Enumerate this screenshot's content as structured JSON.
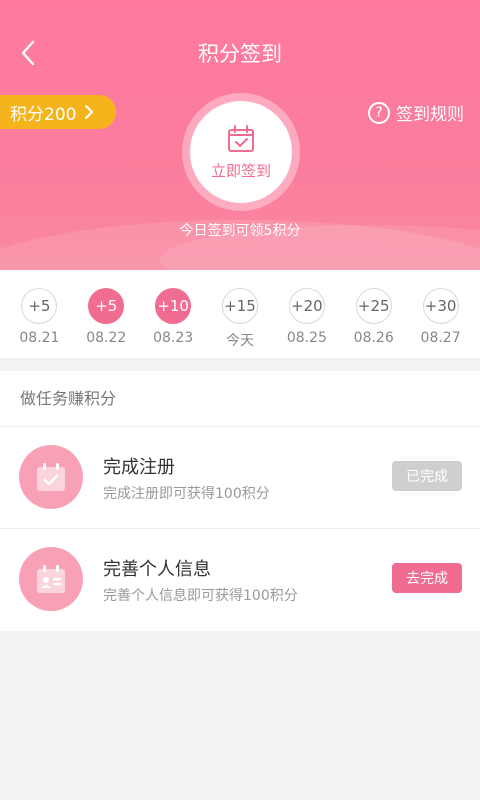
{
  "header": {
    "title": "积分签到",
    "points_label": "积分200",
    "rules_label": "签到规则",
    "sign_button_label": "立即签到",
    "sign_tip": "今日签到可领5积分"
  },
  "days": [
    {
      "points": "+5",
      "date": "08.21",
      "done": false
    },
    {
      "points": "+5",
      "date": "08.22",
      "done": true
    },
    {
      "points": "+10",
      "date": "08.23",
      "done": true
    },
    {
      "points": "+15",
      "date": "今天",
      "done": false
    },
    {
      "points": "+20",
      "date": "08.25",
      "done": false
    },
    {
      "points": "+25",
      "date": "08.26",
      "done": false
    },
    {
      "points": "+30",
      "date": "08.27",
      "done": false
    }
  ],
  "tasks": {
    "heading": "做任务赚积分",
    "items": [
      {
        "title": "完成注册",
        "desc": "完成注册即可获得100积分",
        "button": "已完成",
        "status": "complete"
      },
      {
        "title": "完善个人信息",
        "desc": "完善个人信息即可获得100积分",
        "button": "去完成",
        "status": "pending"
      }
    ]
  },
  "colors": {
    "accent": "#f06c90",
    "header_bg": "#fb7c9d",
    "points_pill": "#f5b41c",
    "task_icon_bg": "#f7a0b6",
    "disabled_button": "#cfcfcf"
  },
  "icons": {
    "back": "chevron-left-icon",
    "points_arrow": "chevron-right-icon",
    "rules": "question-circle-icon",
    "sign": "calendar-check-icon",
    "task_register": "calendar-check-icon",
    "task_profile": "id-card-icon"
  }
}
